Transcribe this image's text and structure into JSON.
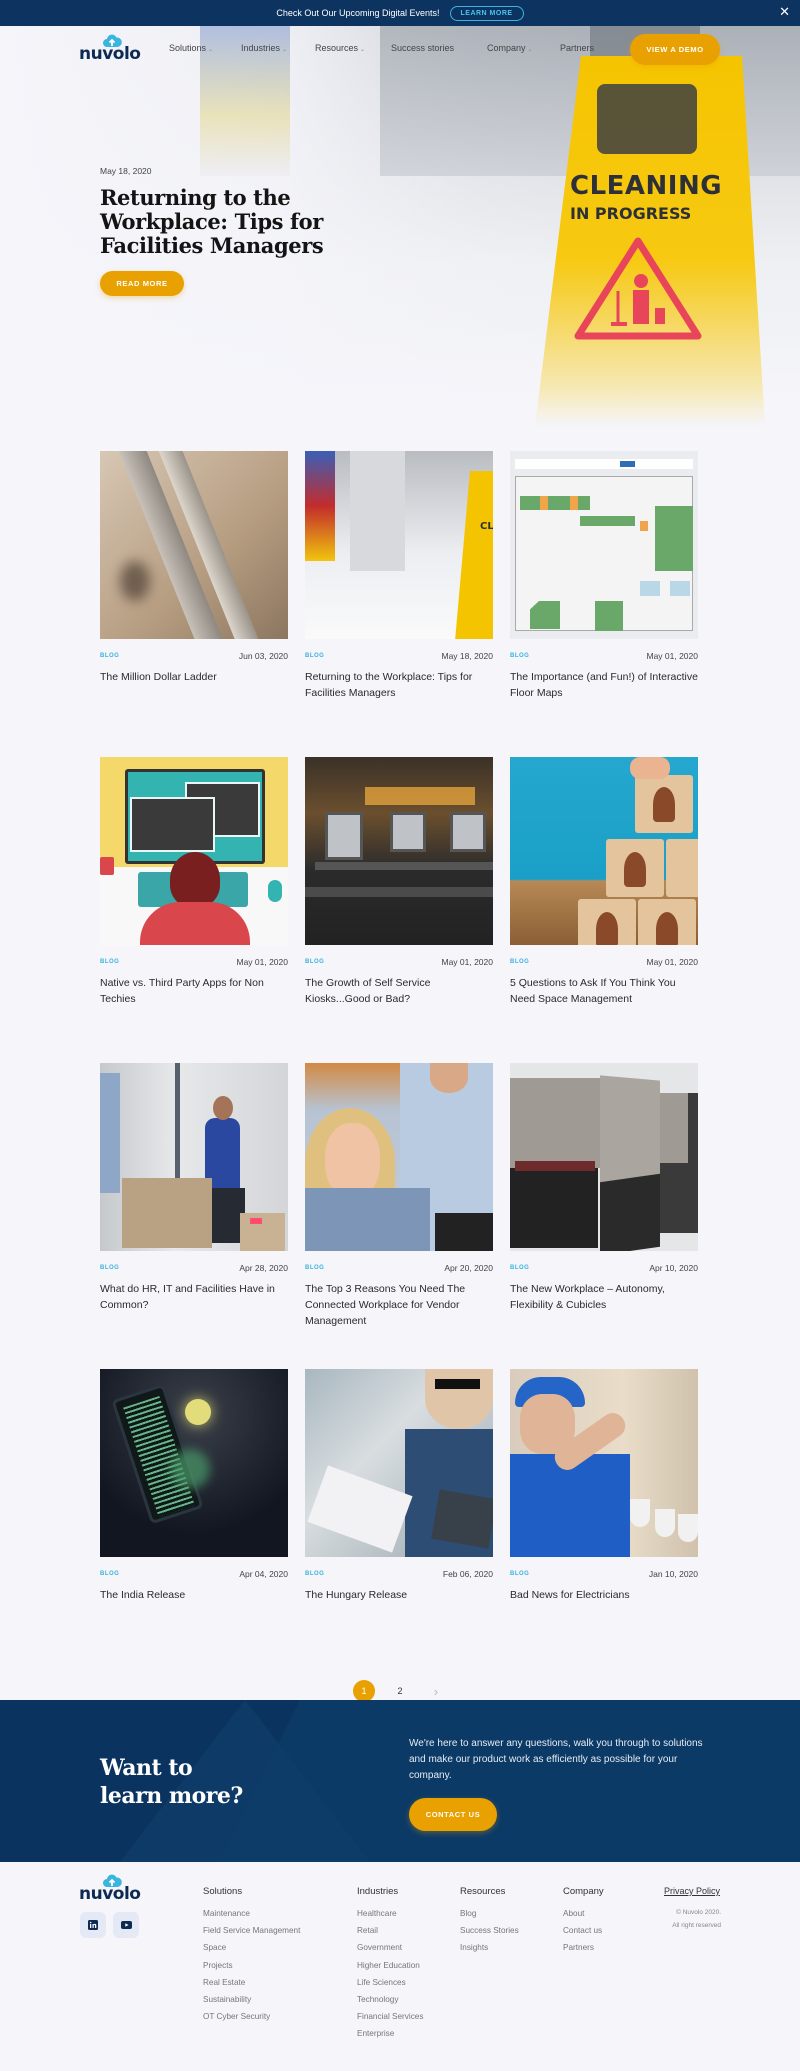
{
  "announcement": {
    "text": "Check Out Our Upcoming Digital Events!",
    "button": "LEARN MORE",
    "close": "✕"
  },
  "nav": {
    "logo": "nuvolo",
    "items": [
      {
        "label": "Solutions",
        "dropdown": true
      },
      {
        "label": "Industries",
        "dropdown": true
      },
      {
        "label": "Resources",
        "dropdown": true
      },
      {
        "label": "Success stories",
        "dropdown": false
      },
      {
        "label": "Company",
        "dropdown": true
      },
      {
        "label": "Partners",
        "dropdown": false
      }
    ],
    "cta": "VIEW A DEMO"
  },
  "hero": {
    "date": "May 18, 2020",
    "title": "Returning to the Workplace: Tips for Facilities Managers",
    "button": "READ MORE",
    "sign_line1": "CLEANING",
    "sign_line2": "IN PROGRESS"
  },
  "posts": [
    {
      "tag": "BLOG",
      "date": "Jun 03, 2020",
      "title": "The Million Dollar Ladder",
      "image": "ladder"
    },
    {
      "tag": "BLOG",
      "date": "May 18, 2020",
      "title": "Returning to the Workplace: Tips for Facilities Managers",
      "image": "cleaning-sign"
    },
    {
      "tag": "BLOG",
      "date": "May 01, 2020",
      "title": "The Importance (and Fun!) of Interactive Floor Maps",
      "image": "floor-map"
    },
    {
      "tag": "BLOG",
      "date": "May 01, 2020",
      "title": "Native vs. Third Party Apps for Non Techies",
      "image": "developer-illustration"
    },
    {
      "tag": "BLOG",
      "date": "May 01, 2020",
      "title": "The Growth of Self Service Kiosks...Good or Bad?",
      "image": "self-checkout-kiosks"
    },
    {
      "tag": "BLOG",
      "date": "May 01, 2020",
      "title": "5 Questions to Ask If You Think You Need Space Management",
      "image": "wooden-blocks-people"
    },
    {
      "tag": "BLOG",
      "date": "Apr 28, 2020",
      "title": "What do HR, IT and Facilities Have in Common?",
      "image": "office-team-boxes"
    },
    {
      "tag": "BLOG",
      "date": "Apr 20, 2020",
      "title": "The Top 3 Reasons You Need The Connected Workplace for Vendor Management",
      "image": "warehouse-colleagues"
    },
    {
      "tag": "BLOG",
      "date": "Apr 10, 2020",
      "title": "The New Workplace – Autonomy, Flexibility & Cubicles",
      "image": "cubicles"
    },
    {
      "tag": "BLOG",
      "date": "Apr 04, 2020",
      "title": "The India Release",
      "image": "phone-code"
    },
    {
      "tag": "BLOG",
      "date": "Feb 06, 2020",
      "title": "The Hungary Release",
      "image": "man-with-tablet"
    },
    {
      "tag": "BLOG",
      "date": "Jan 10, 2020",
      "title": "Bad News for Electricians",
      "image": "electrician"
    }
  ],
  "pagination": {
    "pages": [
      "1",
      "2"
    ],
    "current": "1",
    "next": "›"
  },
  "cta": {
    "title_line1": "Want to",
    "title_line2": "learn more?",
    "text": "We're here to answer any questions, walk you through to solutions and make our product work as efficiently as possible for your company.",
    "button": "CONTACT US"
  },
  "footer": {
    "logo": "nuvolo",
    "social": [
      "linkedin",
      "youtube"
    ],
    "columns": [
      {
        "heading": "Solutions",
        "links": [
          "Maintenance",
          "Field Service Management",
          "Space",
          "Projects",
          "Real Estate",
          "Sustainability",
          "OT Cyber Security"
        ]
      },
      {
        "heading": "Industries",
        "links": [
          "Healthcare",
          "Retail",
          "Government",
          "Higher Education",
          "Life Sciences",
          "Technology",
          "Financial Services",
          "Enterprise"
        ]
      },
      {
        "heading": "Resources",
        "links": [
          "Blog",
          "Success Stories",
          "Insights"
        ]
      },
      {
        "heading": "Company",
        "links": [
          "About",
          "Contact us",
          "Partners"
        ]
      }
    ],
    "privacy": "Privacy Policy",
    "copyright_line1": "© Nuvolo 2020.",
    "copyright_line2": "All right reserved"
  },
  "colors": {
    "navy": "#0d3461",
    "accent_yellow": "#e8a100",
    "tag_blue": "#39b3dc",
    "page_bg": "#f5f5fa"
  }
}
